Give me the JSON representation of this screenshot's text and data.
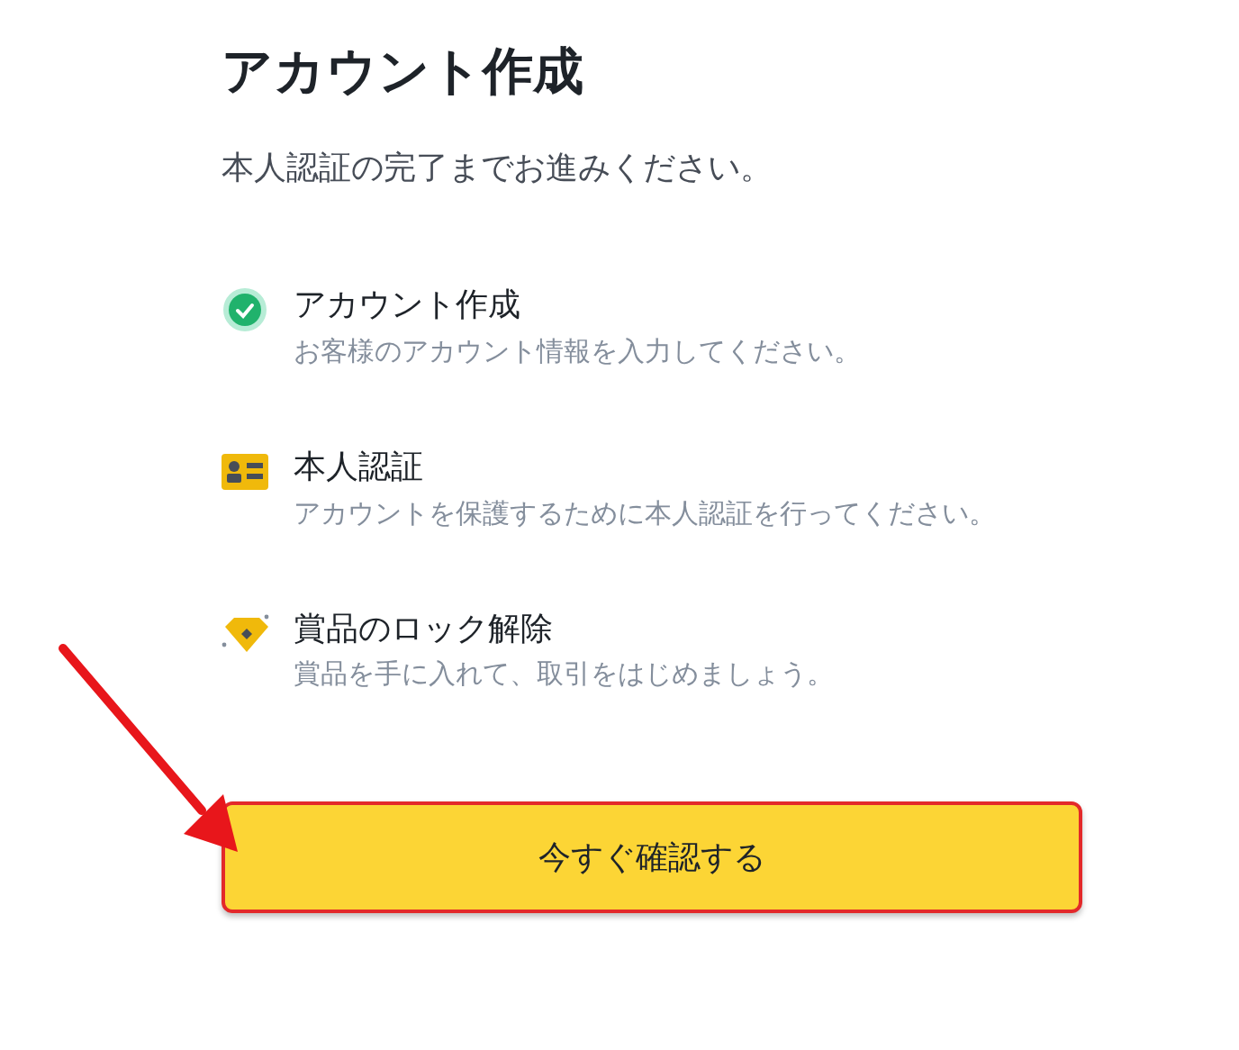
{
  "title": "アカウント作成",
  "subtitle": "本人認証の完了までお進みください。",
  "steps": [
    {
      "kind": "done",
      "title": "アカウント作成",
      "description": "お客様のアカウント情報を入力してください。"
    },
    {
      "kind": "id",
      "title": "本人認証",
      "description": "アカウントを保護するために本人認証を行ってください。"
    },
    {
      "kind": "reward",
      "title": "賞品のロック解除",
      "description": "賞品を手に入れて、取引をはじめましょう。"
    }
  ],
  "button": {
    "label": "今すぐ確認する",
    "highlighted": true
  },
  "annotation": {
    "kind": "arrow"
  }
}
